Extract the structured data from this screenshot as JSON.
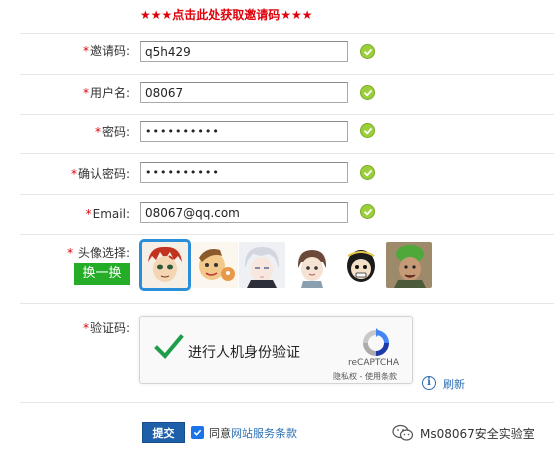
{
  "header": {
    "invite_link": "★★★点击此处获取邀请码★★★"
  },
  "form": {
    "invite": {
      "label": "邀请码:",
      "value": "q5h429"
    },
    "username": {
      "label": "用户名:",
      "value": "08067"
    },
    "password": {
      "label": "密码:",
      "value": "••••••••••"
    },
    "confirm": {
      "label": "确认密码:",
      "value": "••••••••••"
    },
    "email": {
      "label": "Email:",
      "value": "08067@qq.com"
    },
    "required_mark": "*"
  },
  "avatar": {
    "label": "头像选择:",
    "swap_button": "换一换",
    "items": [
      "avatar-1",
      "avatar-2",
      "avatar-3",
      "avatar-4",
      "avatar-5",
      "avatar-6"
    ],
    "selected_index": 0
  },
  "captcha": {
    "label": "验证码:",
    "text": "进行人机身份验证",
    "brand": "reCAPTCHA",
    "links": "隐私权 - 使用条款",
    "info_symbol": "i",
    "refresh": "刷新"
  },
  "footer": {
    "submit": "提交",
    "agree_prefix": "同意",
    "terms": "网站服务条款",
    "watermark": "Ms08067安全实验室"
  },
  "colors": {
    "required": "#e0000b",
    "ok_green": "#9ccf3b",
    "swap_green": "#26ad28",
    "submit_blue": "#1d5fa8",
    "link_blue": "#2b6fb3",
    "select_outline": "#2a8fd8"
  },
  "icons": {
    "valid": "check-circle-icon",
    "captcha_check": "checkmark-icon",
    "captcha_logo": "recaptcha-logo-icon",
    "info": "info-icon",
    "agree": "checkbox-checked-icon",
    "wechat": "wechat-icon"
  }
}
